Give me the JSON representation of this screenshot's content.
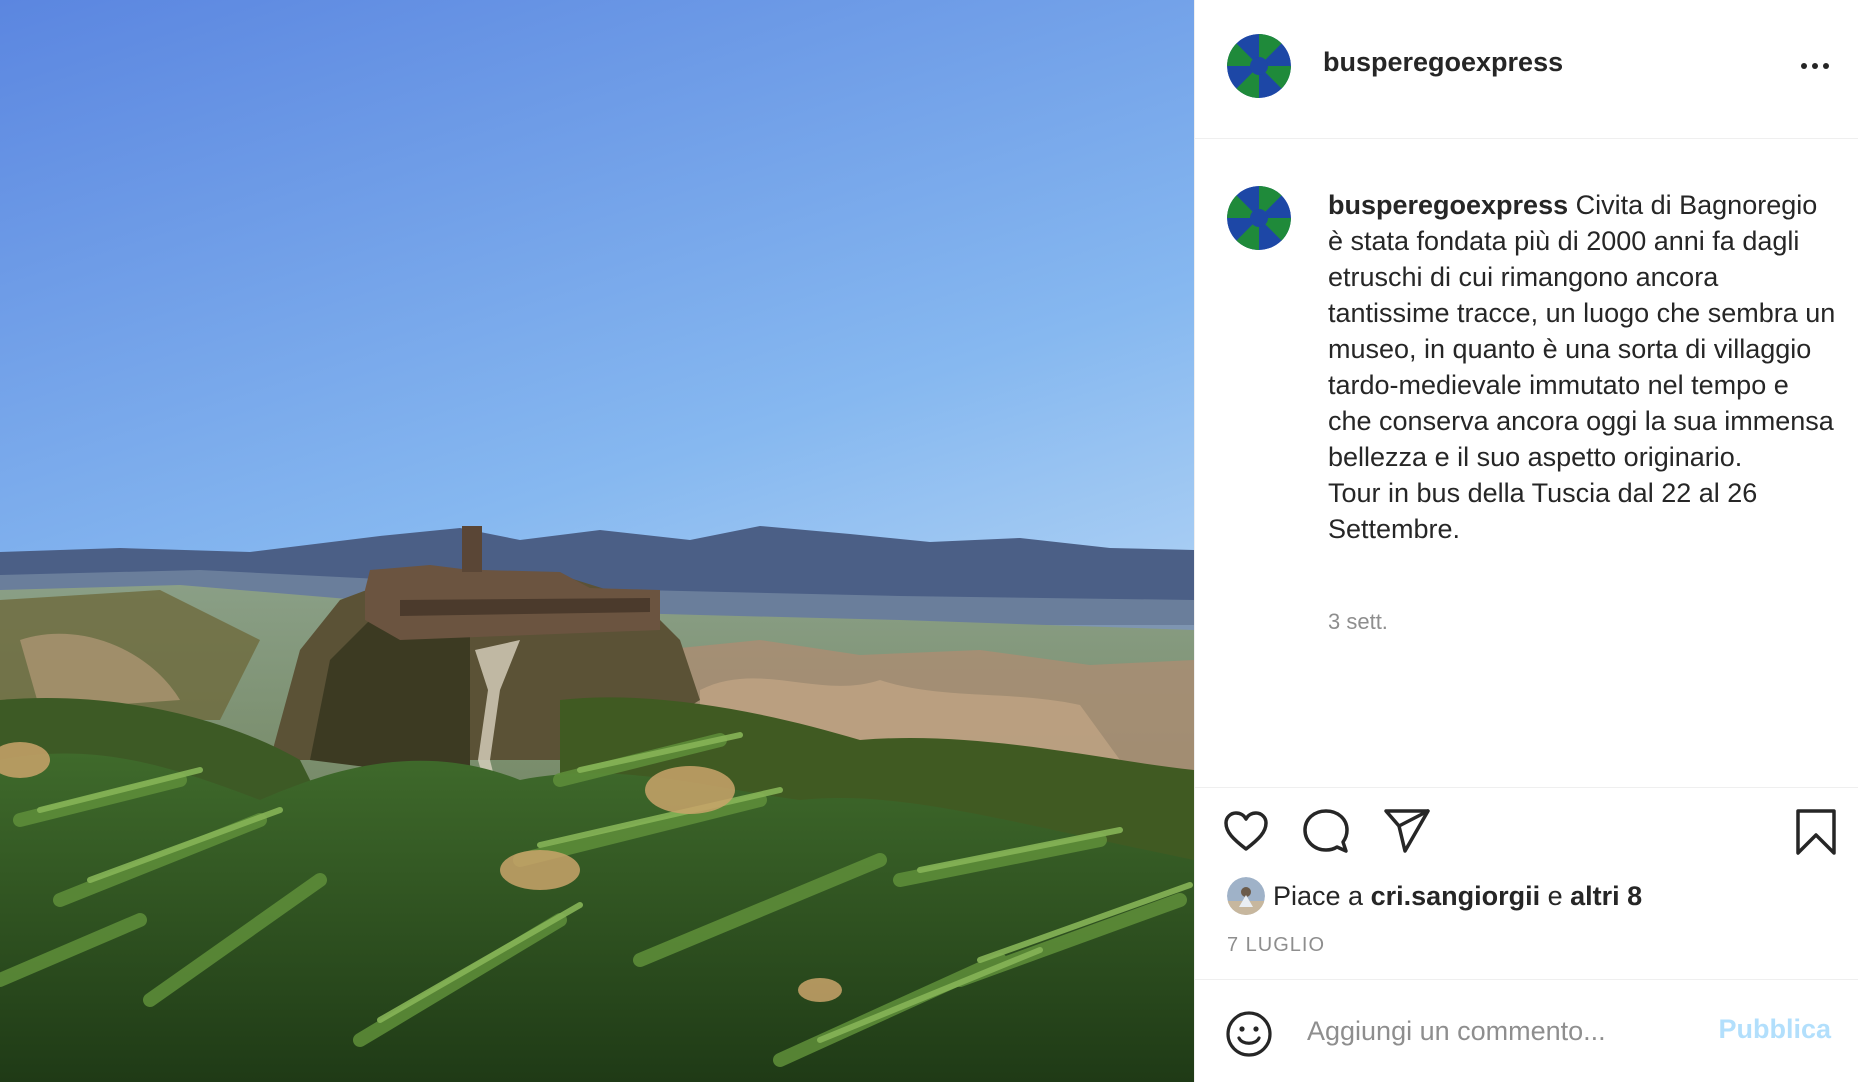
{
  "post": {
    "username": "busperegoexpress",
    "more_icon": "more-horizontal-icon",
    "image_alt": "Civita di Bagnoregio"
  },
  "caption": {
    "username": "busperegoexpress",
    "text": " Civita di Bagnoregio è stata fondata più di 2000 anni fa dagli etruschi di cui rimangono ancora tantissime tracce, un luogo che sembra un museo, in quanto è una sorta di villaggio tardo-medievale immutato nel tempo e che conserva ancora oggi la sua immensa bellezza e il suo aspetto originario.\nTour in bus della Tuscia dal 22 al 26 Settembre.",
    "time_ago": "3 sett."
  },
  "actions": {
    "like_icon": "heart-icon",
    "comment_icon": "comment-bubble-icon",
    "share_icon": "paper-plane-icon",
    "save_icon": "bookmark-icon"
  },
  "likes": {
    "prefix": "Piace a ",
    "user": "cri.sangiorgii",
    "middle": " e ",
    "others": "altri 8"
  },
  "date": "7 LUGLIO",
  "comment_box": {
    "emoji_icon": "smiley-icon",
    "placeholder": "Aggiungi un commento...",
    "publish_label": "Pubblica"
  },
  "colors": {
    "text": "#262626",
    "muted": "#8e8e8e",
    "publish_disabled": "#b2dffc",
    "border": "#efefef",
    "avatar_green": "#1f8a3a",
    "avatar_blue": "#1d47a6"
  }
}
